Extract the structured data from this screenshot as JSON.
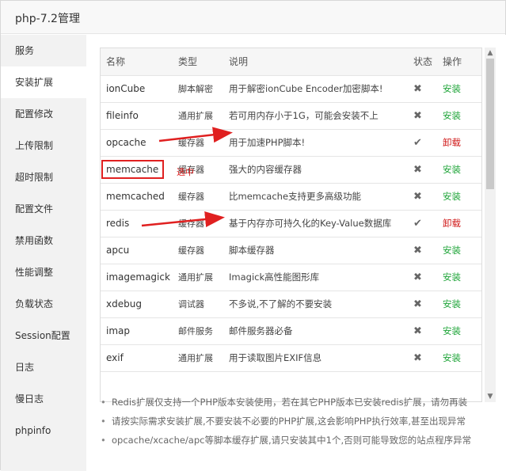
{
  "window": {
    "title": "php-7.2管理"
  },
  "sidebar": {
    "items": [
      {
        "label": "服务"
      },
      {
        "label": "安装扩展",
        "active": true
      },
      {
        "label": "配置修改"
      },
      {
        "label": "上传限制"
      },
      {
        "label": "超时限制"
      },
      {
        "label": "配置文件"
      },
      {
        "label": "禁用函数"
      },
      {
        "label": "性能调整"
      },
      {
        "label": "负载状态"
      },
      {
        "label": "Session配置"
      },
      {
        "label": "日志"
      },
      {
        "label": "慢日志"
      },
      {
        "label": "phpinfo"
      }
    ]
  },
  "table": {
    "headers": {
      "name": "名称",
      "type": "类型",
      "desc": "说明",
      "status": "状态",
      "op": "操作"
    },
    "rows": [
      {
        "name": "ionCube",
        "type": "脚本解密",
        "desc": "用于解密ionCube Encoder加密脚本!",
        "status": "✖",
        "op": "安装"
      },
      {
        "name": "fileinfo",
        "type": "通用扩展",
        "desc": "若可用内存小于1G，可能会安装不上",
        "status": "✖",
        "op": "安装"
      },
      {
        "name": "opcache",
        "type": "缓存器",
        "desc": "用于加速PHP脚本!",
        "status": "✔",
        "op": "卸载"
      },
      {
        "name": "memcache",
        "type": "缓存器",
        "desc": "强大的内容缓存器",
        "status": "✖",
        "op": "安装"
      },
      {
        "name": "memcached",
        "type": "缓存器",
        "desc": "比memcache支持更多高级功能",
        "status": "✖",
        "op": "安装"
      },
      {
        "name": "redis",
        "type": "缓存器",
        "desc": "基于内存亦可持久化的Key-Value数据库",
        "status": "✔",
        "op": "卸载"
      },
      {
        "name": "apcu",
        "type": "缓存器",
        "desc": "脚本缓存器",
        "status": "✖",
        "op": "安装"
      },
      {
        "name": "imagemagick",
        "type": "通用扩展",
        "desc": "Imagick高性能图形库",
        "status": "✖",
        "op": "安装"
      },
      {
        "name": "xdebug",
        "type": "调试器",
        "desc": "不多说,不了解的不要安装",
        "status": "✖",
        "op": "安装"
      },
      {
        "name": "imap",
        "type": "邮件服务",
        "desc": "邮件服务器必备",
        "status": "✖",
        "op": "安装"
      },
      {
        "name": "exif",
        "type": "通用扩展",
        "desc": "用于读取图片EXIF信息",
        "status": "✖",
        "op": "安装"
      }
    ]
  },
  "notes": [
    "Redis扩展仅支持一个PHP版本安装使用，若在其它PHP版本已安装redis扩展，请勿再装",
    "请按实际需求安装扩展,不要安装不必要的PHP扩展,这会影响PHP执行效率,甚至出现异常",
    "opcache/xcache/apc等脚本缓存扩展,请只安装其中1个,否则可能导致您的站点程序异常"
  ],
  "annotation": {
    "text": "选中"
  },
  "colors": {
    "install": "#20a53a",
    "uninstall": "#d01a1a",
    "annotation": "#e02020"
  }
}
